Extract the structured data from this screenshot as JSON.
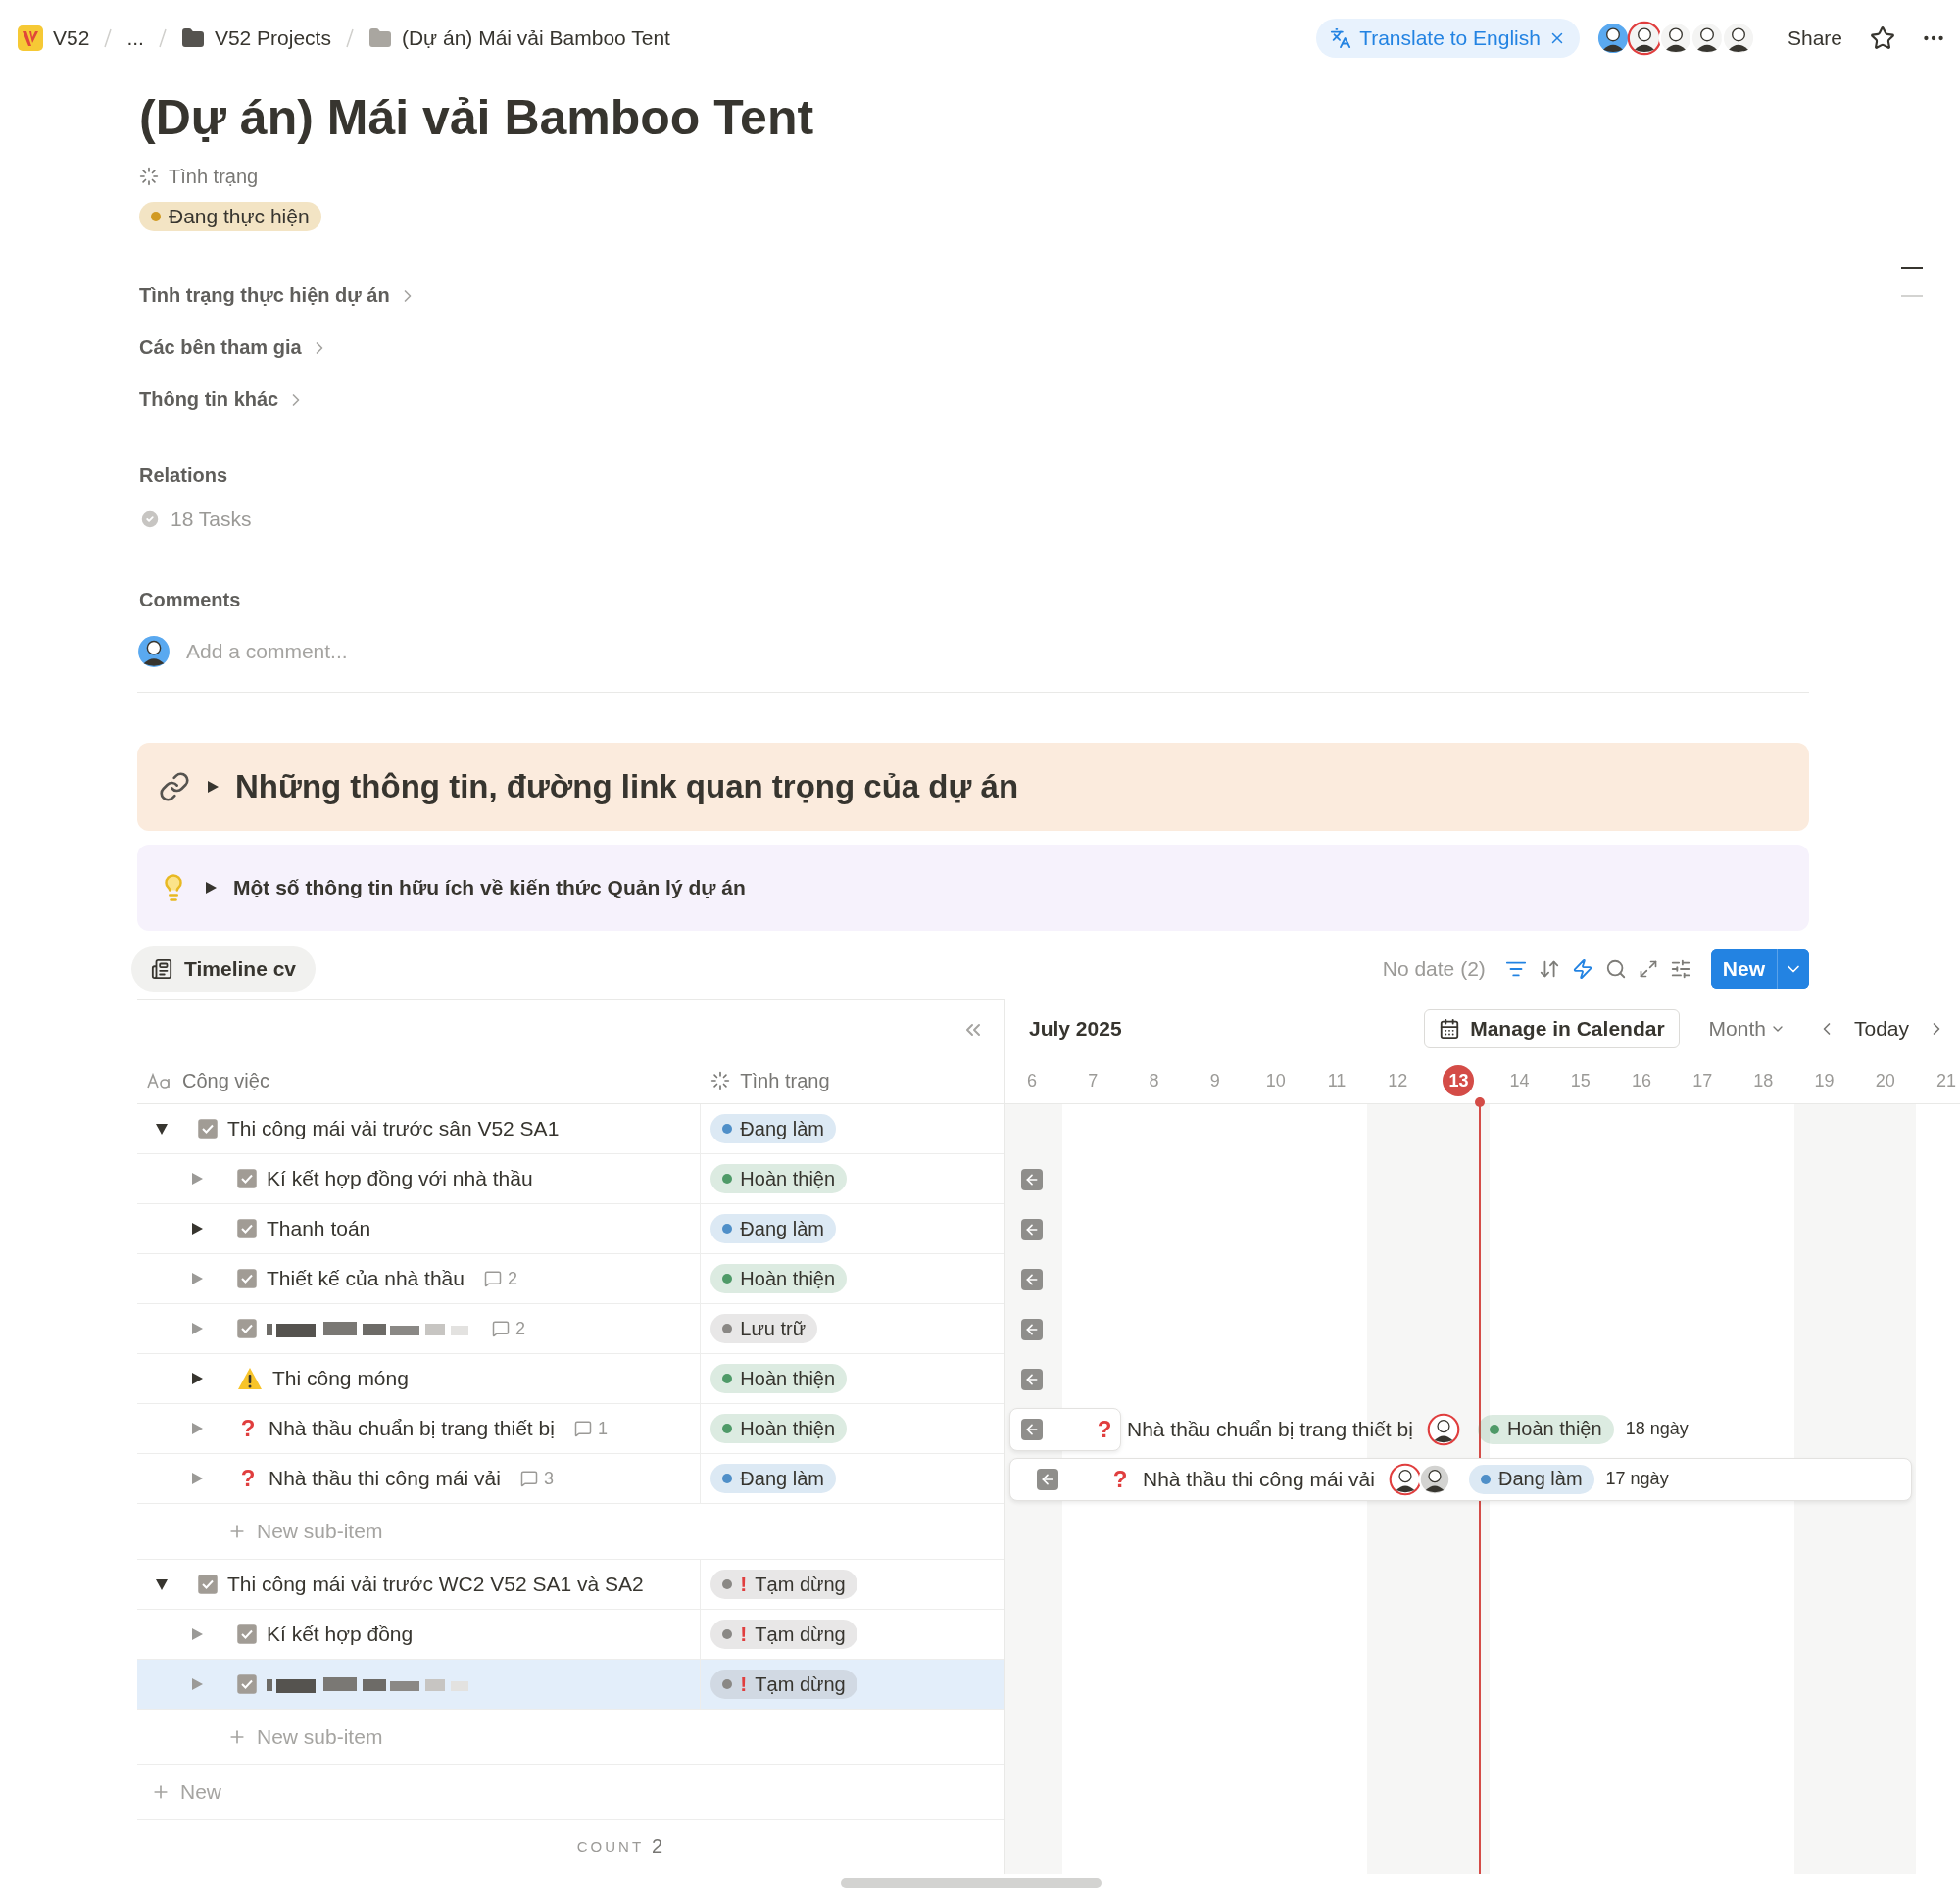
{
  "breadcrumb": [
    {
      "kind": "workspace",
      "label": "V52"
    },
    {
      "kind": "ellipsis",
      "label": "..."
    },
    {
      "kind": "folder",
      "label": "V52 Projects"
    },
    {
      "kind": "page",
      "label": "(Dự án) Mái vải Bamboo Tent"
    }
  ],
  "translate": {
    "label": "Translate to English"
  },
  "presence": [
    {
      "ring": false,
      "active": true
    },
    {
      "ring": true,
      "active": false
    },
    {
      "ring": false,
      "active": false
    },
    {
      "ring": false,
      "active": false
    },
    {
      "ring": false,
      "active": false
    }
  ],
  "share": "Share",
  "title": "(Dự án) Mái vải Bamboo Tent",
  "status_property": {
    "label": "Tình trạng",
    "value": "Đang thực hiện",
    "color": "#d19a22"
  },
  "sections": [
    "Tình trạng thực hiện dự án",
    "Các bên tham gia",
    "Thông tin khác"
  ],
  "relations": {
    "label": "Relations",
    "value": "18 Tasks"
  },
  "comments": {
    "label": "Comments",
    "placeholder": "Add a comment..."
  },
  "callouts": [
    {
      "kind": "link",
      "text": "Những thông tin, đường link quan trọng của dự án",
      "expanded": false
    },
    {
      "kind": "bulb",
      "text": "Một số thông tin hữu ích về kiến thức Quản lý dự án",
      "expanded": false
    }
  ],
  "view": {
    "tab": "Timeline cv",
    "no_date": "No date (2)",
    "new_button": "New"
  },
  "table": {
    "columns": [
      "Công việc",
      "Tình trạng"
    ],
    "groups": [
      {
        "title": "Thi công mái vải trước sân V52 SA1",
        "expanded": true,
        "marker": {
          "kind": "checkbox",
          "checked": true
        },
        "status": {
          "label": "Đang làm",
          "color": "#4f8fc8"
        },
        "new_subitem": "New sub-item",
        "children": [
          {
            "marker": {
              "kind": "checkbox",
              "checked": true
            },
            "title": "Kí kết hợp đồng với nhà thầu",
            "has_children": false,
            "selected": false,
            "offscreen_left": true,
            "status": {
              "label": "Hoàn thiện",
              "color": "#4f9a68"
            }
          },
          {
            "marker": {
              "kind": "checkbox",
              "checked": true
            },
            "title": "Thanh toán",
            "has_children": true,
            "selected": false,
            "offscreen_left": true,
            "status": {
              "label": "Đang làm",
              "color": "#4f8fc8"
            }
          },
          {
            "marker": {
              "kind": "checkbox",
              "checked": true
            },
            "title": "Thiết kế của nhà thầu",
            "comments": "2",
            "has_children": false,
            "selected": false,
            "offscreen_left": true,
            "status": {
              "label": "Hoàn thiện",
              "color": "#4f9a68"
            }
          },
          {
            "marker": {
              "kind": "checkbox",
              "checked": true
            },
            "redacted": true,
            "comments": "2",
            "has_children": false,
            "selected": false,
            "offscreen_left": true,
            "status": {
              "label": "Lưu trữ",
              "color": "#8a8885"
            }
          },
          {
            "marker": {
              "kind": "warning"
            },
            "title": "Thi công móng",
            "has_children": true,
            "selected": false,
            "offscreen_left": true,
            "status": {
              "label": "Hoàn thiện",
              "color": "#4f9a68"
            }
          },
          {
            "marker": {
              "kind": "symbol",
              "text": "?"
            },
            "title": "Nhà thầu chuẩn bị trang thiết bị",
            "comments": "1",
            "has_children": false,
            "selected": false,
            "offscreen_left": true,
            "status": {
              "label": "Hoàn thiện",
              "color": "#4f9a68"
            },
            "bar": {
              "kind": "short",
              "marker": "?",
              "title": "Nhà thầu chuẩn bị trang thiết bị",
              "avatars": [
                {
                  "ring": true
                }
              ],
              "status": {
                "label": "Hoàn thiện",
                "color": "#4f9a68"
              },
              "duration": "18 ngày"
            }
          },
          {
            "marker": {
              "kind": "symbol",
              "text": "?"
            },
            "title": "Nhà thầu thi công mái vải",
            "comments": "3",
            "has_children": false,
            "selected": false,
            "offscreen_left": true,
            "status": {
              "label": "Đang làm",
              "color": "#4f8fc8"
            },
            "bar": {
              "kind": "long",
              "marker": "?",
              "title": "Nhà thầu thi công mái vải",
              "avatars": [
                {
                  "ring": true
                },
                {
                  "ring": false
                }
              ],
              "status": {
                "label": "Đang làm",
                "color": "#4f8fc8"
              },
              "duration": "17 ngày"
            }
          }
        ]
      },
      {
        "title": "Thi công mái vải trước WC2 V52 SA1 và SA2",
        "expanded": true,
        "marker": {
          "kind": "checkbox",
          "checked": true
        },
        "status": {
          "label": "Tạm dừng",
          "color": "#8a8885",
          "flag": "!"
        },
        "new_subitem": "New sub-item",
        "children": [
          {
            "marker": {
              "kind": "checkbox",
              "checked": true
            },
            "title": "Kí kết hợp đồng",
            "has_children": false,
            "selected": false,
            "offscreen_left": false,
            "status": {
              "label": "Tạm dừng",
              "color": "#8a8885",
              "flag": "!"
            }
          },
          {
            "marker": {
              "kind": "checkbox",
              "checked": true
            },
            "redacted": true,
            "has_children": false,
            "selected": true,
            "offscreen_left": false,
            "status": {
              "label": "Tạm dừng",
              "color": "#8a8885",
              "flag": "!"
            }
          }
        ]
      }
    ],
    "new_row": "New",
    "count_label": "COUNT",
    "count": "2"
  },
  "timeline": {
    "month": "July 2025",
    "manage": "Manage in Calendar",
    "scale": "Month",
    "today": "Today",
    "days": [
      {
        "label": "6",
        "weekend": true,
        "selected": false
      },
      {
        "label": "7",
        "weekend": false,
        "selected": false
      },
      {
        "label": "8",
        "weekend": false,
        "selected": false
      },
      {
        "label": "9",
        "weekend": false,
        "selected": false
      },
      {
        "label": "10",
        "weekend": false,
        "selected": false
      },
      {
        "label": "11",
        "weekend": false,
        "selected": false
      },
      {
        "label": "12",
        "weekend": true,
        "selected": false
      },
      {
        "label": "13",
        "weekend": true,
        "selected": true
      },
      {
        "label": "14",
        "weekend": false,
        "selected": false
      },
      {
        "label": "15",
        "weekend": false,
        "selected": false
      },
      {
        "label": "16",
        "weekend": false,
        "selected": false
      },
      {
        "label": "17",
        "weekend": false,
        "selected": false
      },
      {
        "label": "18",
        "weekend": false,
        "selected": false
      },
      {
        "label": "19",
        "weekend": true,
        "selected": false
      },
      {
        "label": "20",
        "weekend": true,
        "selected": false
      },
      {
        "label": "21",
        "weekend": false,
        "selected": false
      }
    ]
  }
}
